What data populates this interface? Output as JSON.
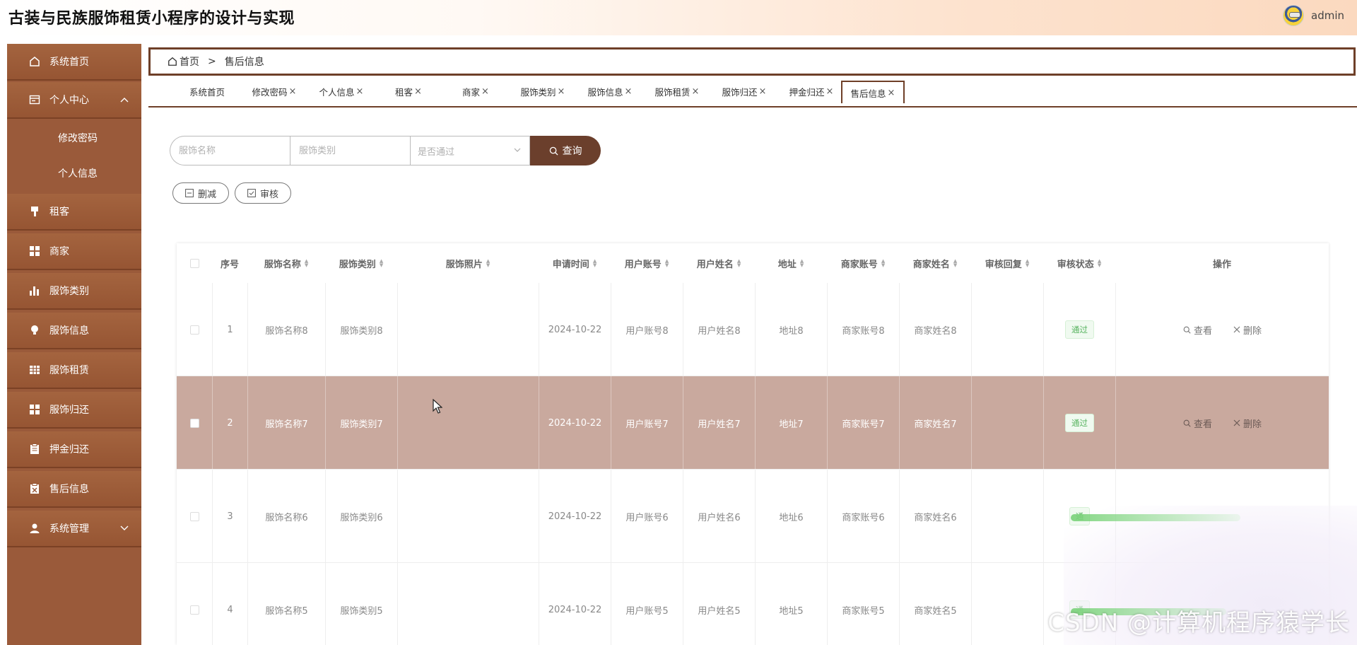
{
  "header": {
    "app_title": "古装与民族服饰租赁小程序的设计与实现",
    "user_name": "admin"
  },
  "sidebar": {
    "items": [
      {
        "label": "系统首页",
        "icon": "home-icon"
      },
      {
        "label": "个人中心",
        "icon": "profile-icon",
        "expanded": true
      },
      {
        "label": "修改密码",
        "sub": true
      },
      {
        "label": "个人信息",
        "sub": true
      },
      {
        "label": "租客",
        "icon": "brush-icon"
      },
      {
        "label": "商家",
        "icon": "grid-icon"
      },
      {
        "label": "服饰类别",
        "icon": "bar-chart-icon"
      },
      {
        "label": "服饰信息",
        "icon": "bulb-icon"
      },
      {
        "label": "服饰租赁",
        "icon": "table-icon"
      },
      {
        "label": "服饰归还",
        "icon": "grid-icon"
      },
      {
        "label": "押金归还",
        "icon": "clipboard-icon"
      },
      {
        "label": "售后信息",
        "icon": "clipboard-x-icon"
      },
      {
        "label": "系统管理",
        "icon": "user-icon",
        "expanded": false
      }
    ]
  },
  "breadcrumb": {
    "home": "首页",
    "separator": ">",
    "current": "售后信息"
  },
  "tabs": [
    {
      "label": "系统首页",
      "closable": false
    },
    {
      "label": "修改密码",
      "closable": true
    },
    {
      "label": "个人信息",
      "closable": true
    },
    {
      "label": "租客",
      "closable": true
    },
    {
      "label": "商家",
      "closable": true
    },
    {
      "label": "服饰类别",
      "closable": true
    },
    {
      "label": "服饰信息",
      "closable": true
    },
    {
      "label": "服饰租赁",
      "closable": true
    },
    {
      "label": "服饰归还",
      "closable": true
    },
    {
      "label": "押金归还",
      "closable": true
    },
    {
      "label": "售后信息",
      "closable": true,
      "active": true
    }
  ],
  "tab_close_glyph": "×",
  "search": {
    "name_placeholder": "服饰名称",
    "category_placeholder": "服饰类别",
    "status_placeholder": "是否通过",
    "button_label": "查询"
  },
  "actions": {
    "delete_label": "删减",
    "audit_label": "审核"
  },
  "table": {
    "columns": [
      "序号",
      "服饰名称",
      "服饰类别",
      "服饰照片",
      "申请时间",
      "用户账号",
      "用户姓名",
      "地址",
      "商家账号",
      "商家姓名",
      "审核回复",
      "审核状态",
      "操作"
    ],
    "rows": [
      {
        "index": "1",
        "name": "服饰名称8",
        "category": "服饰类别8",
        "photo": "",
        "time": "2024-10-22",
        "user_account": "用户账号8",
        "user_name": "用户姓名8",
        "address": "地址8",
        "merchant_account": "商家账号8",
        "merchant_name": "商家姓名8",
        "reply": "",
        "status": "通过"
      },
      {
        "index": "2",
        "name": "服饰名称7",
        "category": "服饰类别7",
        "photo": "",
        "time": "2024-10-22",
        "user_account": "用户账号7",
        "user_name": "用户姓名7",
        "address": "地址7",
        "merchant_account": "商家账号7",
        "merchant_name": "商家姓名7",
        "reply": "",
        "status": "通过",
        "highlighted": true
      },
      {
        "index": "3",
        "name": "服饰名称6",
        "category": "服饰类别6",
        "photo": "",
        "time": "2024-10-22",
        "user_account": "用户账号6",
        "user_name": "用户姓名6",
        "address": "地址6",
        "merchant_account": "商家账号6",
        "merchant_name": "商家姓名6",
        "reply": "",
        "status": "通"
      },
      {
        "index": "4",
        "name": "服饰名称5",
        "category": "服饰类别5",
        "photo": "",
        "time": "2024-10-22",
        "user_account": "用户账号5",
        "user_name": "用户姓名5",
        "address": "地址5",
        "merchant_account": "商家账号5",
        "merchant_name": "商家姓名5",
        "reply": "",
        "status": "通"
      }
    ],
    "view_label": "查看",
    "delete_label": "删除"
  },
  "watermark": "CSDN @计算机程序猿学长",
  "colors": {
    "sidebar": "#9a5a3a",
    "accent": "#6b3f2c",
    "row_highlight": "#c9a99e",
    "status_green": "#56b35e"
  }
}
